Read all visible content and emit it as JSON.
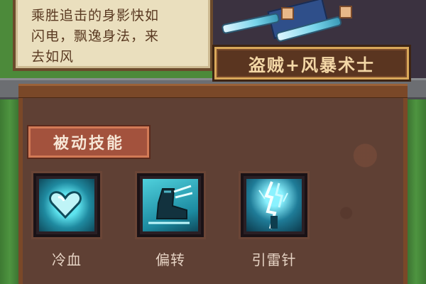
{
  "description": {
    "lines": [
      "乘胜追击的身影快如",
      "闪电，飘逸身法，来",
      "去如风"
    ]
  },
  "class_title": "盗贼+风暴术士",
  "passive_section": {
    "header": "被动技能",
    "skills": [
      {
        "name": "冷血",
        "icon": "ice-heart-icon"
      },
      {
        "name": "偏转",
        "icon": "wind-boot-icon"
      },
      {
        "name": "引雷针",
        "icon": "lightning-rod-icon"
      }
    ]
  },
  "colors": {
    "panel_brown": "#5f4034",
    "header_red": "#a3523d",
    "skill_cyan": "#3fc7d6",
    "plaque_text": "#f3d7a6"
  }
}
